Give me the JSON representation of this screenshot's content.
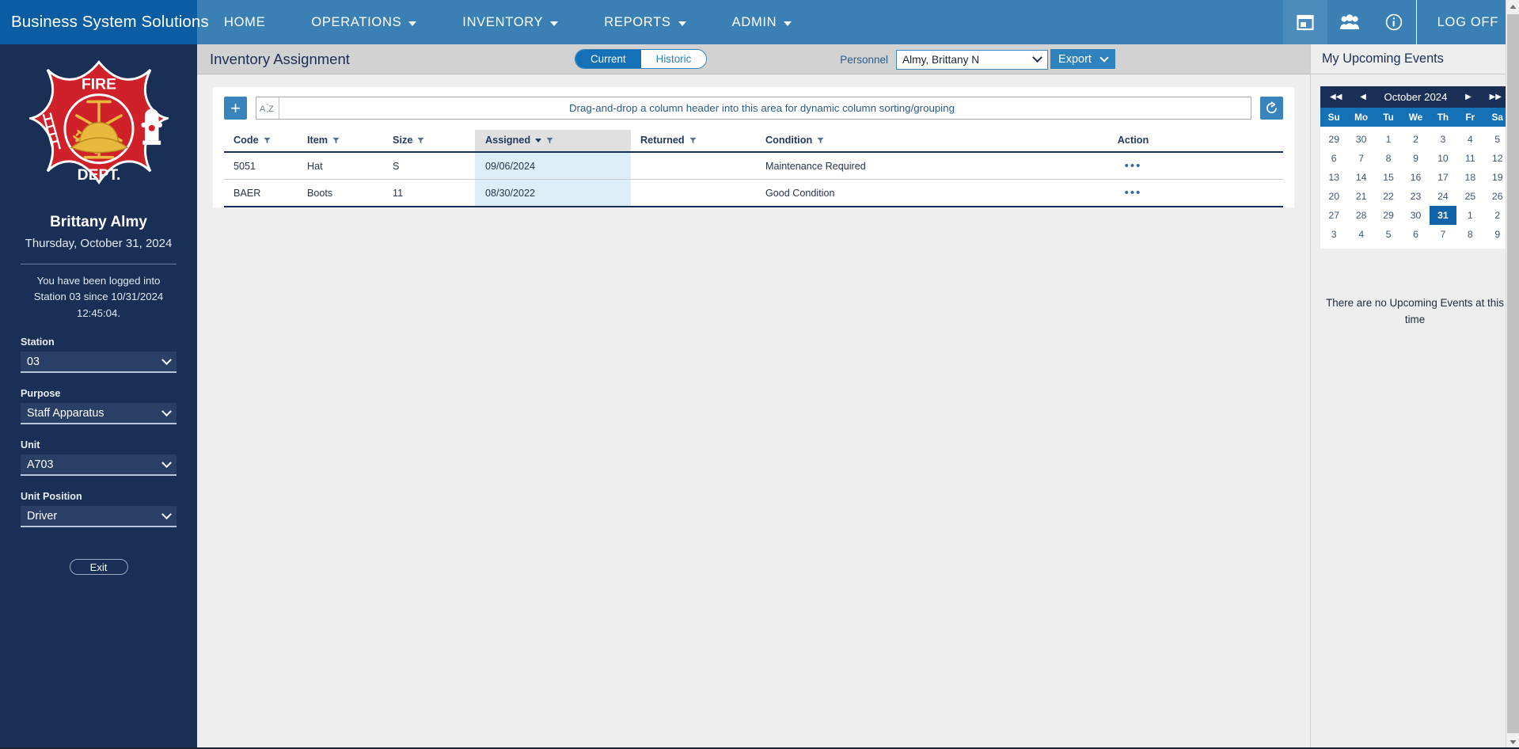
{
  "topnav": {
    "brand": "Business System Solutions",
    "items": [
      {
        "label": "HOME",
        "has_caret": false
      },
      {
        "label": "OPERATIONS",
        "has_caret": true
      },
      {
        "label": "INVENTORY",
        "has_caret": true
      },
      {
        "label": "REPORTS",
        "has_caret": true
      },
      {
        "label": "ADMIN",
        "has_caret": true
      }
    ],
    "icons": [
      "calendar-icon",
      "people-icon",
      "info-icon"
    ],
    "logoff": "LOG OFF"
  },
  "sidebar": {
    "logo": {
      "top_text": "FIRE",
      "bottom_text": "DEPT."
    },
    "user_name": "Brittany Almy",
    "user_date": "Thursday, October 31, 2024",
    "logged_message": "You have been logged into Station 03 since 10/31/2024 12:45:04.",
    "fields": [
      {
        "label": "Station",
        "value": "03"
      },
      {
        "label": "Purpose",
        "value": "Staff Apparatus"
      },
      {
        "label": "Unit",
        "value": "A703"
      },
      {
        "label": "Unit Position",
        "value": "Driver"
      }
    ],
    "exit_label": "Exit"
  },
  "page": {
    "title": "Inventory Assignment",
    "toggle": {
      "on": "Current",
      "off": "Historic"
    },
    "personnel_label": "Personnel",
    "personnel_value": "Almy, Brittany N",
    "export_label": "Export"
  },
  "grid": {
    "add_label": "+",
    "group_hint": "Drag-and-drop a column header into this area for dynamic column sorting/grouping",
    "sort_icon": "AZ",
    "refresh_icon": "refresh-icon",
    "columns": [
      {
        "label": "Code",
        "filter": true,
        "sorted": false
      },
      {
        "label": "Item",
        "filter": true,
        "sorted": false
      },
      {
        "label": "Size",
        "filter": true,
        "sorted": false
      },
      {
        "label": "Assigned",
        "filter": true,
        "sorted": true,
        "sort_dir": "desc"
      },
      {
        "label": "Returned",
        "filter": true,
        "sorted": false
      },
      {
        "label": "Condition",
        "filter": true,
        "sorted": false
      },
      {
        "label": "Action",
        "filter": false,
        "sorted": false
      }
    ],
    "rows": [
      {
        "code": "5051",
        "item": "Hat",
        "size": "S",
        "assigned": "09/06/2024",
        "returned": "",
        "condition": "Maintenance Required",
        "action": "•••"
      },
      {
        "code": "BAER",
        "item": "Boots",
        "size": "11",
        "assigned": "08/30/2022",
        "returned": "",
        "condition": "Good Condition",
        "action": "•••"
      }
    ]
  },
  "rightpanel": {
    "title": "My Upcoming Events",
    "calendar": {
      "month_title": "October 2024",
      "dow": [
        "Su",
        "Mo",
        "Tu",
        "We",
        "Th",
        "Fr",
        "Sa"
      ],
      "days": [
        "29",
        "30",
        "1",
        "2",
        "3",
        "4",
        "5",
        "6",
        "7",
        "8",
        "9",
        "10",
        "11",
        "12",
        "13",
        "14",
        "15",
        "16",
        "17",
        "18",
        "19",
        "20",
        "21",
        "22",
        "23",
        "24",
        "25",
        "26",
        "27",
        "28",
        "29",
        "30",
        "31",
        "1",
        "2",
        "3",
        "4",
        "5",
        "6",
        "7",
        "8",
        "9"
      ],
      "today_index": 32
    },
    "no_events": "There are no Upcoming Events at this time"
  },
  "colors": {
    "brand_blue": "#0a5ca3",
    "nav_blue": "#3a80b5",
    "sidebar_navy": "#1a2f55",
    "accent": "#2e82bd",
    "sorted_cell": "#dceef7",
    "logo_red": "#d0202a"
  }
}
